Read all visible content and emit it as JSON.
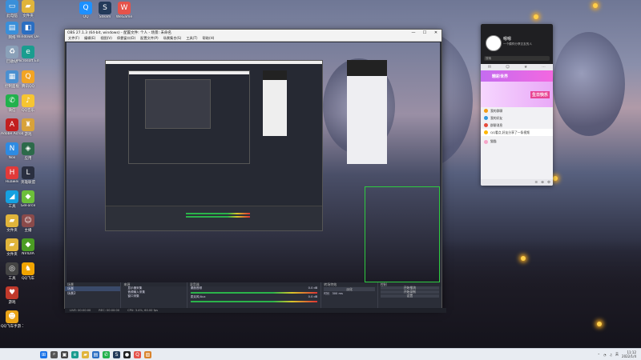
{
  "desktop_icons": [
    {
      "label": "此电脑",
      "glyph": "▭",
      "color": "#3a8fd9"
    },
    {
      "label": "文件夹",
      "glyph": "▰",
      "color": "#e0b43b"
    },
    {
      "label": "QQ",
      "glyph": "Q",
      "color": "#1e90ff"
    },
    {
      "label": "Steam",
      "glyph": "S",
      "color": "#233a5a"
    },
    {
      "label": "WeGame",
      "glyph": "W",
      "color": "#e5534b"
    },
    {
      "label": "网络",
      "glyph": "▤",
      "color": "#3a8fd9"
    },
    {
      "label": "Windows Defender",
      "glyph": "◧",
      "color": "#2a6ec2"
    },
    {
      "label": "回收站",
      "glyph": "♻",
      "color": "#8aa0b8"
    },
    {
      "label": "Microsoft Edge",
      "glyph": "e",
      "color": "#1a9d8f"
    },
    {
      "label": "控制面板",
      "glyph": "▦",
      "color": "#4a8fd0"
    },
    {
      "label": "腾讯QQ",
      "glyph": "Q",
      "color": "#f2a424"
    },
    {
      "label": "微信",
      "glyph": "✆",
      "color": "#22b14c"
    },
    {
      "label": "QQ音乐",
      "glyph": "♪",
      "color": "#f7c531"
    },
    {
      "label": "Adobe Acrobat",
      "glyph": "A",
      "color": "#c21f1f"
    },
    {
      "label": "游戏",
      "glyph": "♜",
      "color": "#d8a23a"
    },
    {
      "label": "Nox",
      "glyph": "N",
      "color": "#2e8be3"
    },
    {
      "label": "应用",
      "glyph": "◈",
      "color": "#2c6a4a"
    },
    {
      "label": "Huawei",
      "glyph": "H",
      "color": "#e13a3a"
    },
    {
      "label": "英雄联盟",
      "glyph": "L",
      "color": "#2a2f40"
    },
    {
      "label": "工具",
      "glyph": "◢",
      "color": "#15a0e0"
    },
    {
      "label": "GeForce",
      "glyph": "◆",
      "color": "#6cbf3a"
    },
    {
      "label": "文件夹",
      "glyph": "▰",
      "color": "#e0b43b"
    },
    {
      "label": "主播",
      "glyph": "☺",
      "color": "#8a4a4a"
    },
    {
      "label": "文件夹",
      "glyph": "▰",
      "color": "#e0b43b"
    },
    {
      "label": "NVIDIA",
      "glyph": "◆",
      "color": "#4b9d23"
    },
    {
      "label": "工具",
      "glyph": "◎",
      "color": "#444"
    },
    {
      "label": "QQ飞车",
      "glyph": "♞",
      "color": "#f0a400"
    },
    {
      "label": "游戏",
      "glyph": "♥",
      "color": "#c0392b"
    },
    {
      "label": "QQ飞车手游 工具",
      "glyph": "☻",
      "color": "#e8a317"
    }
  ],
  "obs": {
    "title": "OBS 27.1.3 (64-bit, windows) - 配置文件: 个人 - 场景: 未命名",
    "menu": [
      "文件(F)",
      "编辑(E)",
      "视图(V)",
      "停靠窗口(D)",
      "配置文件(P)",
      "场景集合(S)",
      "工具(T)",
      "帮助(H)"
    ],
    "window_controls": [
      "—",
      "☐",
      "✕"
    ],
    "toolbar": {
      "source_label": "显示器采集",
      "properties": "属性",
      "filters": "滤镜",
      "display": "显示器",
      "display_value": "\\\\.\\DISPLAY1 (xxx) 1440"
    },
    "docks": {
      "scenes": {
        "title": "场景",
        "items": [
          "场景",
          "场景2"
        ]
      },
      "sources": {
        "title": "来源",
        "items": [
          "显示器采集",
          "音频输入采集",
          "窗口采集",
          "游戏源",
          "文本 (GDI+)",
          "图像",
          "浏览器"
        ]
      },
      "mixer": {
        "title": "混音器",
        "channels": [
          {
            "name": "桌面音频",
            "level": "0.0 dB"
          },
          {
            "name": "麦克风/Aux",
            "level": "0.0 dB"
          }
        ]
      },
      "transitions": {
        "title": "转场特效",
        "type": "淡化",
        "duration_label": "时长",
        "duration": "300 ms"
      },
      "controls": {
        "title": "控制",
        "buttons": [
          "开始推流",
          "开始录制",
          "启动虚拟摄像机",
          "工作室模式",
          "设置",
          "退出"
        ]
      }
    },
    "status": {
      "live": "LIVE: 00:00:00",
      "rec": "REC: 00:00:00",
      "cpu": "CPU: 3.4%, 60.00 fps"
    }
  },
  "chat": {
    "nickname": "嗯嗯",
    "signature": "一个模样分享交友的人",
    "search_placeholder": "搜索",
    "banner": "精彩世界",
    "promo_text": "生日快乐",
    "items": [
      {
        "text": "我的群聊",
        "color": "#f39c12"
      },
      {
        "text": "我的好友",
        "color": "#3498db"
      },
      {
        "text": "群聊消息",
        "color": "#e74c3c"
      },
      {
        "text": "设备",
        "color": "#2ecc71"
      }
    ],
    "message": "QQ看点,好友分享了一条视频",
    "friend": "猫猫"
  },
  "taskbar": {
    "apps": [
      {
        "name": "start",
        "glyph": "⊞",
        "color": "#1a73e8"
      },
      {
        "name": "search",
        "glyph": "⌕",
        "color": "#555"
      },
      {
        "name": "taskview",
        "glyph": "▣",
        "color": "#444"
      },
      {
        "name": "edge",
        "glyph": "e",
        "color": "#1a9d8f"
      },
      {
        "name": "explorer",
        "glyph": "▰",
        "color": "#e0b43b"
      },
      {
        "name": "store",
        "glyph": "▤",
        "color": "#2a6ec2"
      },
      {
        "name": "wechat",
        "glyph": "✆",
        "color": "#22b14c"
      },
      {
        "name": "steam",
        "glyph": "S",
        "color": "#233a5a"
      },
      {
        "name": "obs",
        "glyph": "●",
        "color": "#222"
      },
      {
        "name": "qq",
        "glyph": "Q",
        "color": "#e5534b"
      },
      {
        "name": "app",
        "glyph": "▨",
        "color": "#d9832b"
      }
    ],
    "tray": {
      "lang": "英",
      "time": "11:12",
      "date": "2022/1/4"
    }
  }
}
